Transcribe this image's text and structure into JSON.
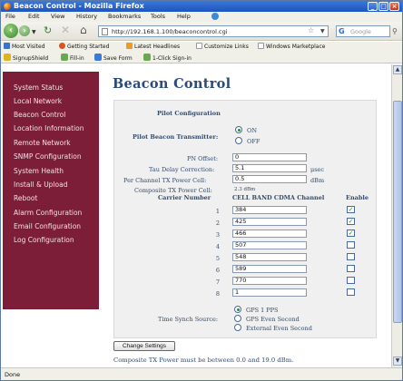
{
  "window": {
    "title": "Beacon Control - Mozilla Firefox"
  },
  "menubar": {
    "items": [
      "File",
      "Edit",
      "View",
      "History",
      "Bookmarks",
      "Tools",
      "Help"
    ]
  },
  "navbar": {
    "url": "http://192.168.1.100/beaconcontrol.cgi",
    "search_placeholder": "Google"
  },
  "bookmarks": {
    "items": [
      "Most Visited",
      "Getting Started",
      "Latest Headlines",
      "Customize Links",
      "Windows Marketplace"
    ]
  },
  "addons": {
    "items": [
      "SignupShield",
      "Fill-in",
      "Save Form",
      "1-Click Sign-in"
    ]
  },
  "sidebar": {
    "items": [
      "System Status",
      "Local Network",
      "Beacon Control",
      "Location Information",
      "Remote Network",
      "SNMP Configuration",
      "System Health",
      "Install & Upload",
      "Reboot",
      "Alarm Configuration",
      "Email Configuration",
      "Log Configuration"
    ]
  },
  "page": {
    "title": "Beacon Control"
  },
  "form": {
    "section_title": "Pilot Configuration",
    "pilot_transmitter_label": "Pilot Beacon Transmitter:",
    "pilot_on_label": "ON",
    "pilot_off_label": "OFF",
    "pilot_selected": "ON",
    "pn_offset_label": "PN Offset:",
    "pn_offset_value": "0",
    "tau_label": "Tau Delay Correction:",
    "tau_value": "5.1",
    "tau_unit": "μsec",
    "per_channel_label": "Per Channel TX Power Cell:",
    "per_channel_value": "0.5",
    "per_channel_unit": "dBm",
    "composite_label": "Composite TX Power Cell:",
    "composite_value": "2.3 dBm",
    "col_carrier": "Carrier Number",
    "col_channel": "CELL BAND CDMA Channel",
    "col_enable": "Enable",
    "carriers": [
      {
        "number": "1",
        "channel": "384",
        "enabled": true
      },
      {
        "number": "2",
        "channel": "425",
        "enabled": true
      },
      {
        "number": "3",
        "channel": "466",
        "enabled": true
      },
      {
        "number": "4",
        "channel": "507",
        "enabled": false
      },
      {
        "number": "5",
        "channel": "548",
        "enabled": false
      },
      {
        "number": "6",
        "channel": "589",
        "enabled": false
      },
      {
        "number": "7",
        "channel": "770",
        "enabled": false
      },
      {
        "number": "8",
        "channel": "1",
        "enabled": false
      }
    ],
    "time_sync_label": "Time Synch Source:",
    "time_sync_options": [
      "GPS 1 PPS",
      "GPS Even Second",
      "External Even Second"
    ],
    "time_sync_selected": "GPS 1 PPS",
    "change_button": "Change Settings",
    "warning": "Composite TX Power must be between 0.0 and 19.0 dBm."
  },
  "status": {
    "text": "Done"
  },
  "colors": {
    "sidebar_bg": "#7d1e38",
    "title_color": "#2a4a7a",
    "titlebar": "#1b55c0"
  }
}
